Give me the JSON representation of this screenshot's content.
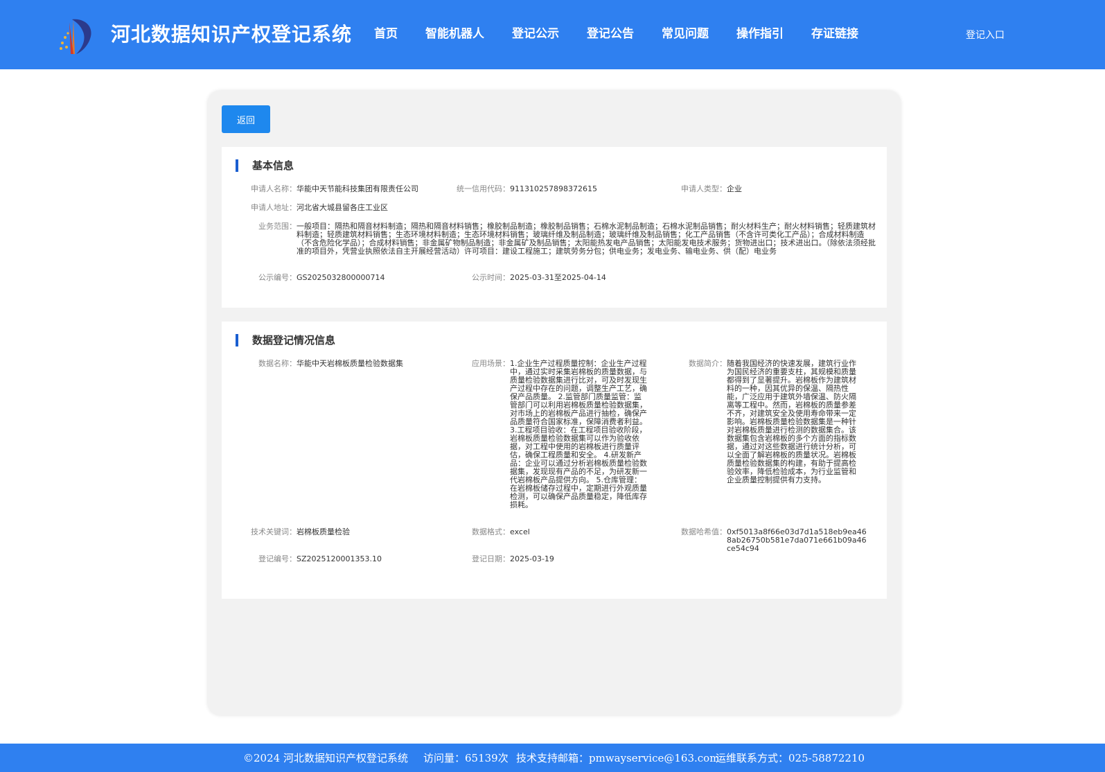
{
  "header": {
    "site_title": "河北数据知识产权登记系统",
    "nav": [
      "首页",
      "智能机器人",
      "登记公示",
      "登记公告",
      "常见问题",
      "操作指引",
      "存证链接"
    ],
    "login": "登记入口"
  },
  "back_button": "返回",
  "basic_info": {
    "title": "基本信息",
    "applicant_name_label": "申请人名称：",
    "applicant_name": "华能中天节能科技集团有限责任公司",
    "credit_code_label": "统一信用代码：",
    "credit_code": "911310257898372615",
    "applicant_type_label": "申请人类型：",
    "applicant_type": "企业",
    "address_label": "申请人地址：",
    "address": "河北省大城县留各庄工业区",
    "scope_label": "业务范围：",
    "scope": "一般项目：隔热和隔音材料制造；隔热和隔音材料销售；橡胶制品制造；橡胶制品销售；石棉水泥制品制造；石棉水泥制品销售；耐火材料生产；耐火材料销售；轻质建筑材料制造；轻质建筑材料销售；生态环境材料制造；生态环境材料销售；玻璃纤维及制品制造；玻璃纤维及制品销售；化工产品销售（不含许可类化工产品）；合成材料制造（不含危险化学品）；合成材料销售；非金属矿物制品制造；非金属矿及制品销售；太阳能热发电产品销售；太阳能发电技术服务；货物进出口；技术进出口。（除依法须经批准的项目外，凭营业执照依法自主开展经营活动）许可项目：建设工程施工；建筑劳务分包；供电业务；发电业务、输电业务、供（配）电业务",
    "pub_no_label": "公示编号：",
    "pub_no": "GS2025032800000714",
    "pub_time_label": "公示时间：",
    "pub_time": "2025-03-31至2025-04-14"
  },
  "data_info": {
    "title": "数据登记情况信息",
    "data_name_label": "数据名称：",
    "data_name": "华能中天岩棉板质量检验数据集",
    "scenario_label": "应用场景：",
    "scenario": "1.企业生产过程质量控制：企业生产过程中，通过实时采集岩棉板的质量数据，与质量检验数据集进行比对，可及时发现生产过程中存在的问题，调整生产工艺，确保产品质量。 2.监管部门质量监管：监管部门可以利用岩棉板质量检验数据集，对市场上的岩棉板产品进行抽检，确保产品质量符合国家标准，保障消费者利益。3.工程项目验收：在工程项目验收阶段，岩棉板质量检验数据集可以作为验收依据，对工程中使用的岩棉板进行质量评估，确保工程质量和安全。 4.研发新产品：企业可以通过分析岩棉板质量检验数据集，发现现有产品的不足，为研发新一代岩棉板产品提供方向。 5.仓库管理：在岩棉板储存过程中，定期进行外观质量检测，可以确保产品质量稳定，降低库存损耗。",
    "intro_label": "数据简介：",
    "intro": "随着我国经济的快速发展，建筑行业作为国民经济的重要支柱，其规模和质量都得到了显著提升。岩棉板作为建筑材料的一种，因其优异的保温、隔热性能，广泛应用于建筑外墙保温、防火隔离等工程中。然而，岩棉板的质量参差不齐，对建筑安全及使用寿命带来一定影响。岩棉板质量检验数据集是一种针对岩棉板质量进行检测的数据集合。该数据集包含岩棉板的多个方面的指标数据，通过对这些数据进行统计分析，可以全面了解岩棉板的质量状况。岩棉板质量检验数据集的构建，有助于提高检验效率，降低检验成本，为行业监管和企业质量控制提供有力支持。",
    "keywords_label": "技术关键词：",
    "keywords": "岩棉板质量检验",
    "format_label": "数据格式：",
    "format": "excel",
    "hash_label": "数据哈希值：",
    "hash": "0xf5013a8f66e03d7d1a518eb9ea468ab26750b581e7da071e661b09a46ce54c94",
    "reg_no_label": "登记编号：",
    "reg_no": "SZ2025120001353.10",
    "reg_date_label": "登记日期：",
    "reg_date": "2025-03-19"
  },
  "footer": {
    "copyright": "©2024 河北数据知识产权登记系统",
    "visits": "访问量：65139次",
    "email": "技术支持邮箱：pmwayservice@163.com",
    "phone": "运维联系方式：025-58872210"
  }
}
